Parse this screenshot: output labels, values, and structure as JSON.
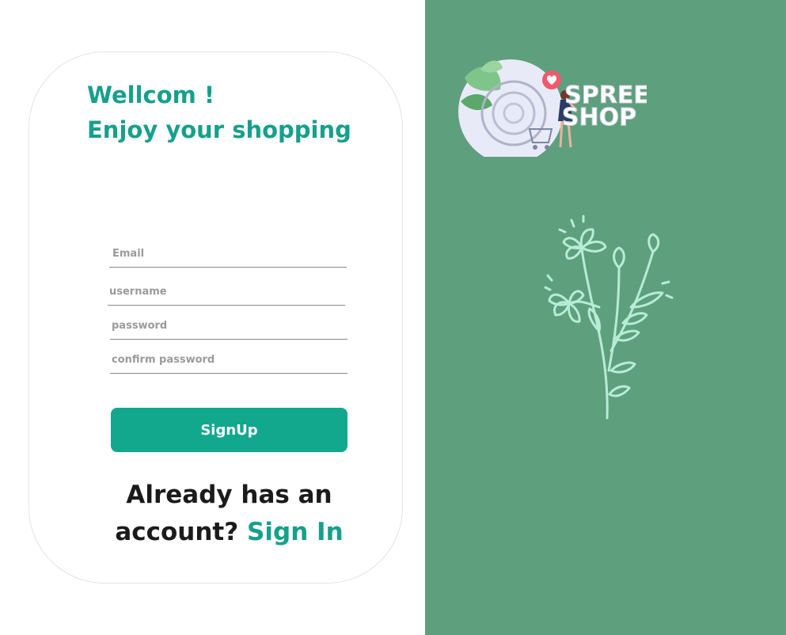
{
  "greeting": {
    "line1": "Wellcom !",
    "line2": "Enjoy your shopping"
  },
  "form": {
    "email_placeholder": "Email",
    "username_placeholder": "username",
    "password_placeholder": "password",
    "confirm_password_placeholder": "confirm password",
    "submit_label": "SignUp"
  },
  "footer": {
    "prompt": "Already has an account?",
    "link_label": "Sign In"
  },
  "brand": {
    "logo_line1": "SPREE",
    "logo_line2": "SHOP"
  },
  "colors": {
    "accent": "#16a08c",
    "button": "#12a88e",
    "panel": "#5e9f7d"
  },
  "icons": [
    "shop-logo-icon",
    "flower-illustration-icon"
  ]
}
